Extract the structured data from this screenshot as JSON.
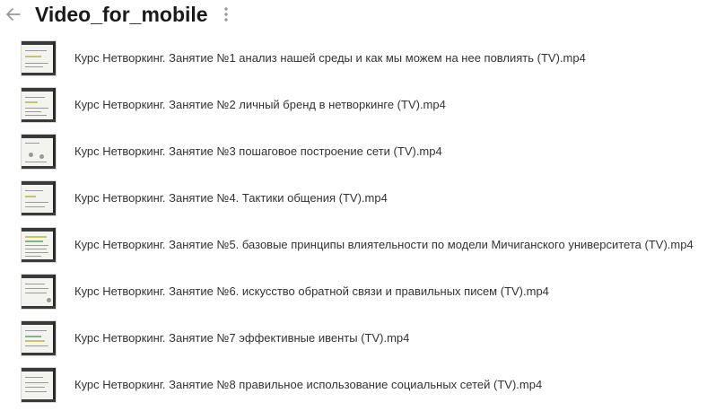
{
  "header": {
    "title": "Video_for_mobile",
    "back_icon": "arrow-left-icon",
    "more_icon": "more-vertical-icon"
  },
  "files": [
    {
      "name": "Курс Нетворкинг. Занятие №1 анализ нашей среды и как мы можем на нее повлиять (TV).mp4"
    },
    {
      "name": "Курс Нетворкинг. Занятие №2 личный бренд в нетворкинге (TV).mp4"
    },
    {
      "name": "Курс Нетворкинг. Занятие №3 пошаговое построение сети (TV).mp4"
    },
    {
      "name": "Курс Нетворкинг. Занятие №4. Тактики общения (TV).mp4"
    },
    {
      "name": "Курс Нетворкинг. Занятие №5. базовые принципы влиятельности по модели Мичиганского университета (TV).mp4"
    },
    {
      "name": "Курс Нетворкинг. Занятие №6. искусство обратной связи и правильных писем (TV).mp4"
    },
    {
      "name": "Курс Нетворкинг. Занятие №7 эффективные ивенты (TV).mp4"
    },
    {
      "name": "Курс Нетворкинг. Занятие №8 правильное использование социальных сетей (TV).mp4"
    }
  ]
}
